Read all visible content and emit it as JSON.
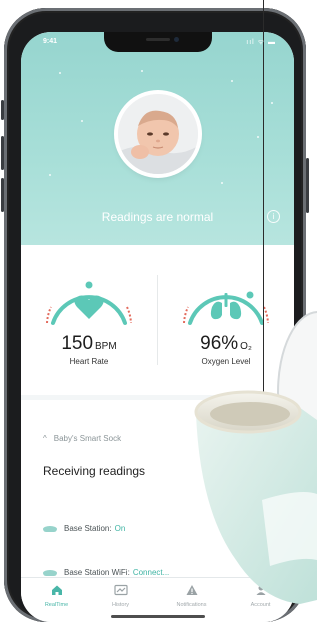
{
  "status_bar": {
    "time": "9:41",
    "icons": "ııl ᯤ ▬"
  },
  "hero": {
    "status_text": "Readings are normal",
    "info_icon": "i"
  },
  "cards": [
    {
      "value": "150",
      "unit": "BPM",
      "label": "Heart Rate",
      "icon": "heart-icon"
    },
    {
      "value": "96%",
      "unit": "O₂",
      "label": "Oxygen Level",
      "icon": "lungs-icon"
    }
  ],
  "sock": {
    "section_title": "Baby's Smart Sock",
    "receiving": "Receiving readings",
    "rows": [
      {
        "label": "Base Station:",
        "value": "On"
      },
      {
        "label": "Base Station WiFi:",
        "value": "Connect..."
      }
    ]
  },
  "tabbar": {
    "tabs": [
      {
        "label": "RealTime",
        "icon": "home-icon",
        "active": true
      },
      {
        "label": "History",
        "icon": "history-icon",
        "active": false
      },
      {
        "label": "Notifications",
        "icon": "alert-icon",
        "active": false
      },
      {
        "label": "Account",
        "icon": "account-icon",
        "active": false
      }
    ]
  },
  "colors": {
    "accent": "#49b6a8",
    "hero_top": "#96d5cf",
    "gauge_green": "#5cc8b7",
    "gauge_red": "#e36b5d"
  }
}
